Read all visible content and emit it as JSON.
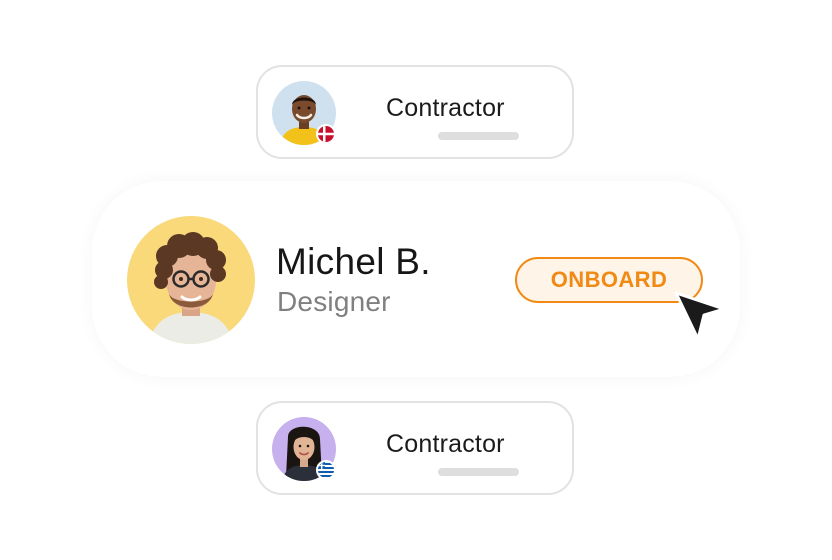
{
  "cards": {
    "top": {
      "label": "Contractor",
      "flag_icon": "denmark-flag-icon",
      "avatar_color": "#cfe0ef"
    },
    "main": {
      "name": "Michel B.",
      "role": "Designer",
      "action_label": "ONBOARD",
      "avatar_color": "#f9d979",
      "accent_color": "#f08a14"
    },
    "bottom": {
      "label": "Contractor",
      "flag_icon": "greece-flag-icon",
      "avatar_color": "#c6b0ee"
    }
  },
  "cursor_icon": "mouse-pointer-icon"
}
